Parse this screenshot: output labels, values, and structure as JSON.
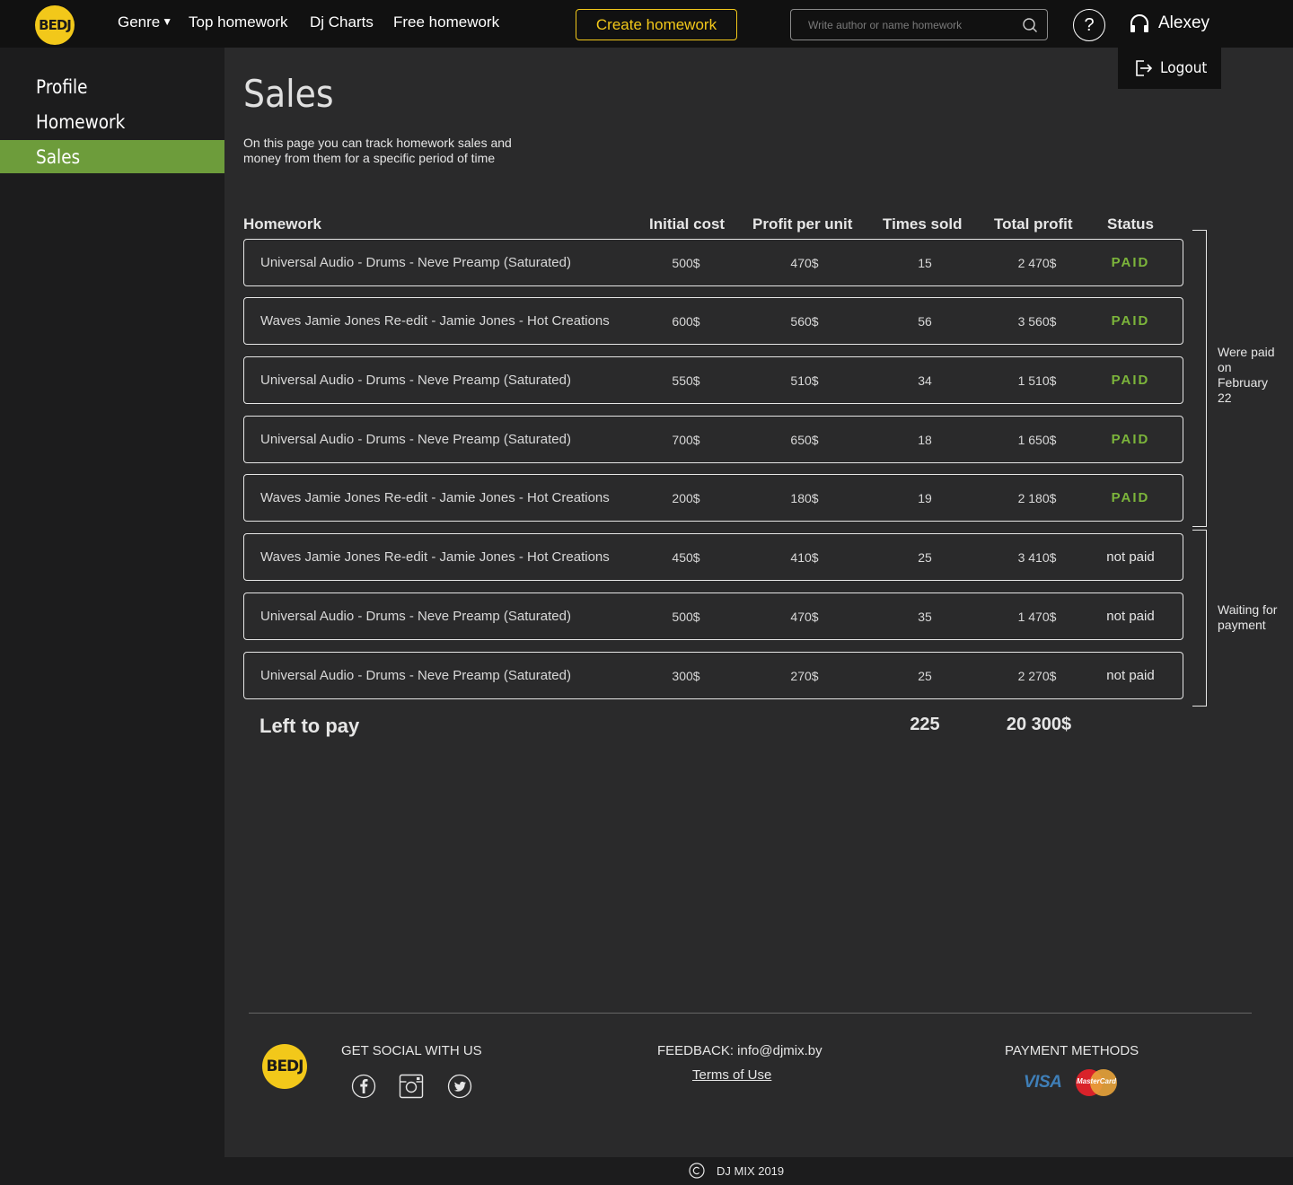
{
  "brand": {
    "logo_text": "BEDJ",
    "accent": "#f2c81a",
    "active_green": "#6d9c3b",
    "paid_green": "#7cb53b"
  },
  "nav": {
    "genre": "Genre",
    "top_homework": "Top homework",
    "dj_charts": "Dj Charts",
    "free_homework": "Free homework",
    "create_button": "Create homework",
    "search_placeholder": "Write author or name homework",
    "help": "?",
    "user_name": "Alexey",
    "logout": "Logout"
  },
  "sidebar": {
    "items": [
      {
        "label": "Profile",
        "active": false
      },
      {
        "label": "Homework",
        "active": false
      },
      {
        "label": "Sales",
        "active": true
      }
    ]
  },
  "main": {
    "title": "Sales",
    "description": "On this page you can track homework sales and money from them for a specific period of time"
  },
  "table": {
    "headers": [
      "Homework",
      "Initial cost",
      "Profit per unit",
      "Times sold",
      "Total profit",
      "Status"
    ],
    "rows": [
      {
        "name": "Universal Audio - Drums - Neve Preamp (Saturated)",
        "initial": "500$",
        "ppu": "470$",
        "times": "15",
        "total": "2 470$",
        "status": "PAID",
        "paid": true
      },
      {
        "name": "Waves Jamie Jones Re-edit - Jamie Jones - Hot Creations",
        "initial": "600$",
        "ppu": "560$",
        "times": "56",
        "total": "3 560$",
        "status": "PAID",
        "paid": true
      },
      {
        "name": "Universal Audio - Drums - Neve Preamp (Saturated)",
        "initial": "550$",
        "ppu": "510$",
        "times": "34",
        "total": "1 510$",
        "status": "PAID",
        "paid": true
      },
      {
        "name": "Universal Audio - Drums - Neve Preamp (Saturated)",
        "initial": "700$",
        "ppu": "650$",
        "times": "18",
        "total": "1 650$",
        "status": "PAID",
        "paid": true
      },
      {
        "name": "Waves Jamie Jones Re-edit - Jamie Jones - Hot Creations",
        "initial": "200$",
        "ppu": "180$",
        "times": "19",
        "total": "2 180$",
        "status": "PAID",
        "paid": true
      },
      {
        "name": "Waves Jamie Jones Re-edit - Jamie Jones - Hot Creations",
        "initial": "450$",
        "ppu": "410$",
        "times": "25",
        "total": "3 410$",
        "status": "not paid",
        "paid": false
      },
      {
        "name": "Universal Audio - Drums - Neve Preamp (Saturated)",
        "initial": "500$",
        "ppu": "470$",
        "times": "35",
        "total": "1 470$",
        "status": "not paid",
        "paid": false
      },
      {
        "name": "Universal Audio - Drums - Neve Preamp (Saturated)",
        "initial": "300$",
        "ppu": "270$",
        "times": "25",
        "total": "2 270$",
        "status": "not paid",
        "paid": false
      }
    ],
    "groups": {
      "paid_label": "Were paid on February 22",
      "waiting_label": "Waiting for payment"
    },
    "summary": {
      "label": "Left to pay",
      "times": "225",
      "total": "20 300$"
    }
  },
  "footer": {
    "social_title": "GET SOCIAL WITH US",
    "social_icons": [
      "facebook-icon",
      "instagram-icon",
      "twitter-icon"
    ],
    "feedback": "FEEDBACK: info@djmix.by",
    "terms": "Terms of Use",
    "payment_title": "PAYMENT METHODS",
    "visa": "VISA",
    "mastercard": "MasterCard",
    "copyright": "DJ MIX 2019"
  }
}
